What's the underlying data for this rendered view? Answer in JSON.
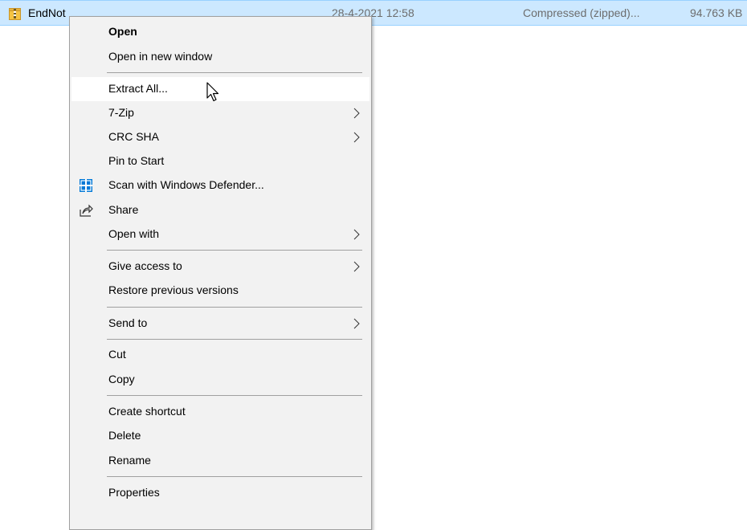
{
  "file": {
    "name": "EndNot",
    "date": "28-4-2021 12:58",
    "type": "Compressed (zipped)...",
    "size": "94.763 KB"
  },
  "menu": {
    "open": "Open",
    "open_new_window": "Open in new window",
    "extract_all": "Extract All...",
    "seven_zip": "7-Zip",
    "crc_sha": "CRC SHA",
    "pin_to_start": "Pin to Start",
    "scan_defender": "Scan with Windows Defender...",
    "share": "Share",
    "open_with": "Open with",
    "give_access": "Give access to",
    "restore_versions": "Restore previous versions",
    "send_to": "Send to",
    "cut": "Cut",
    "copy": "Copy",
    "create_shortcut": "Create shortcut",
    "delete": "Delete",
    "rename": "Rename",
    "properties": "Properties"
  },
  "colors": {
    "selection": "#cce8ff",
    "menu_bg": "#f2f2f2",
    "highlight": "#ffffff",
    "defender_blue": "#0078d7"
  },
  "icons": {
    "zip": "zip-folder-icon",
    "defender": "windows-defender-icon",
    "share": "share-icon",
    "arrow": "chevron-right-icon",
    "cursor": "mouse-pointer-icon"
  }
}
